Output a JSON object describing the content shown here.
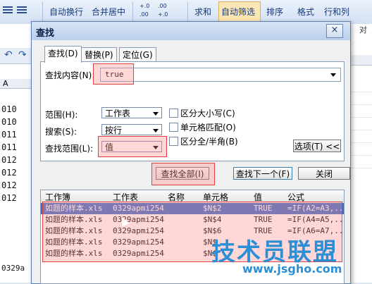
{
  "ribbon": {
    "items": [
      "自动换行",
      "合并居中",
      "求和",
      "自动筛选",
      "排序",
      "格式",
      "行和列"
    ],
    "active": "自动筛选",
    "num_format": [
      "+.0",
      ".00",
      ".00",
      "+.0"
    ],
    "right_hint": "对"
  },
  "sheet": {
    "column": "A",
    "cells": [
      "010",
      "010",
      "011",
      "011",
      "012",
      "012",
      "012",
      "012"
    ],
    "bottom": "0329a"
  },
  "dialog": {
    "title": "查找",
    "close": "×",
    "tabs": [
      "查找(D)",
      "替换(P)",
      "定位(G)"
    ],
    "find_label": "查找内容(N):",
    "find_value": "true",
    "scope_label": "范围(H):",
    "scope_value": "工作表",
    "search_label": "搜索(S):",
    "search_value": "按行",
    "lookin_label": "查找范围(L):",
    "lookin_value": "值",
    "options": [
      "区分大小写(C)",
      "单元格匹配(O)",
      "区分全/半角(B)"
    ],
    "options_button": "选项(T) <<",
    "find_all": "查找全部(I)",
    "find_next": "查找下一个(F)",
    "close_button": "关闭"
  },
  "results": {
    "columns": [
      "工作簿",
      "工作表",
      "名称",
      "单元格",
      "值",
      "公式"
    ],
    "rows": [
      [
        "如题的样本.xls",
        "0329apmi254",
        "",
        "$N$2",
        "TRUE",
        "=IF(A2=A3,..."
      ],
      [
        "如题的样本.xls",
        "0329apmi254",
        "",
        "$N$4",
        "TRUE",
        "=IF(A4=A5,..."
      ],
      [
        "如题的样本.xls",
        "0329apmi254",
        "",
        "$N$6",
        "TRUE",
        "=IF(A6=A7,..."
      ],
      [
        "如题的样本.xls",
        "0329apmi254",
        "",
        "$N$",
        "",
        ""
      ],
      [
        "如题的样本.xls",
        "0329apmi254",
        "",
        "$N$",
        "",
        ""
      ]
    ]
  },
  "watermark": {
    "main": "技术员联盟",
    "url": "www.jsgho.com"
  },
  "colors": {
    "highlight": "#e04040",
    "selected": "#3a6fc6",
    "titlebar": "#b9cfec"
  }
}
